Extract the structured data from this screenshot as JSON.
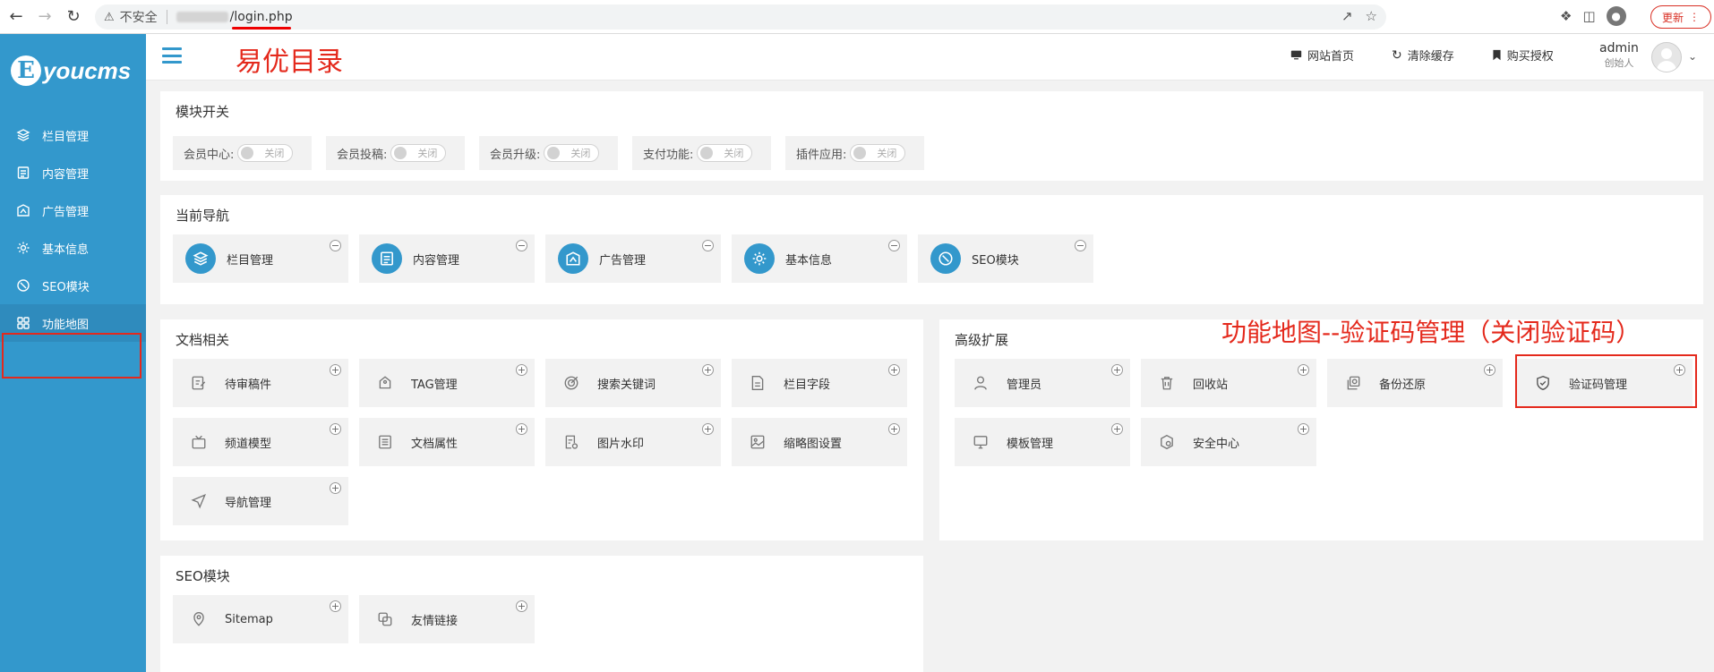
{
  "browser": {
    "insecure_label": "不安全",
    "url_path": "/login.php",
    "update_label": "更新"
  },
  "sidebar": {
    "logo_text": "youcms",
    "items": [
      {
        "label": "栏目管理",
        "icon": "layers-icon"
      },
      {
        "label": "内容管理",
        "icon": "document-icon"
      },
      {
        "label": "广告管理",
        "icon": "ad-icon"
      },
      {
        "label": "基本信息",
        "icon": "gear-icon"
      },
      {
        "label": "SEO模块",
        "icon": "seo-icon"
      },
      {
        "label": "功能地图",
        "icon": "grid-icon",
        "active": true
      }
    ]
  },
  "header": {
    "annotation": "易优目录",
    "links": [
      {
        "label": "网站首页",
        "icon": "monitor-icon"
      },
      {
        "label": "清除缓存",
        "icon": "refresh-icon"
      },
      {
        "label": "购买授权",
        "icon": "bookmark-icon"
      }
    ],
    "user_name": "admin",
    "user_role": "创始人"
  },
  "module_switch": {
    "title": "模块开关",
    "items": [
      {
        "label": "会员中心:",
        "state": "关闭"
      },
      {
        "label": "会员投稿:",
        "state": "关闭"
      },
      {
        "label": "会员升级:",
        "state": "关闭"
      },
      {
        "label": "支付功能:",
        "state": "关闭"
      },
      {
        "label": "插件应用:",
        "state": "关闭"
      }
    ]
  },
  "current_nav": {
    "title": "当前导航",
    "items": [
      {
        "label": "栏目管理",
        "icon": "layers-icon"
      },
      {
        "label": "内容管理",
        "icon": "document-icon"
      },
      {
        "label": "广告管理",
        "icon": "ad-icon"
      },
      {
        "label": "基本信息",
        "icon": "gear-icon"
      },
      {
        "label": "SEO模块",
        "icon": "seo-icon"
      }
    ],
    "corner": "−"
  },
  "doc_related": {
    "title": "文档相关",
    "items": [
      {
        "label": "待审稿件",
        "icon": "edit-icon"
      },
      {
        "label": "TAG管理",
        "icon": "tag-icon"
      },
      {
        "label": "搜索关键词",
        "icon": "target-icon"
      },
      {
        "label": "栏目字段",
        "icon": "file-icon"
      },
      {
        "label": "频道模型",
        "icon": "tv-icon"
      },
      {
        "label": "文档属性",
        "icon": "list-icon"
      },
      {
        "label": "图片水印",
        "icon": "watermark-icon"
      },
      {
        "label": "缩略图设置",
        "icon": "image-icon"
      },
      {
        "label": "导航管理",
        "icon": "navigation-icon"
      }
    ],
    "corner": "+"
  },
  "advanced": {
    "title": "高级扩展",
    "annotation": "功能地图--验证码管理（关闭验证码）",
    "items": [
      {
        "label": "管理员",
        "icon": "user-icon"
      },
      {
        "label": "回收站",
        "icon": "trash-icon"
      },
      {
        "label": "备份还原",
        "icon": "backup-icon"
      },
      {
        "label": "验证码管理",
        "icon": "shield-icon"
      },
      {
        "label": "模板管理",
        "icon": "monitor-icon"
      },
      {
        "label": "安全中心",
        "icon": "security-icon"
      }
    ],
    "corner": "+"
  },
  "seo": {
    "title": "SEO模块",
    "items": [
      {
        "label": "Sitemap",
        "icon": "sitemap-icon"
      },
      {
        "label": "友情链接",
        "icon": "link-icon"
      }
    ],
    "corner": "+"
  }
}
